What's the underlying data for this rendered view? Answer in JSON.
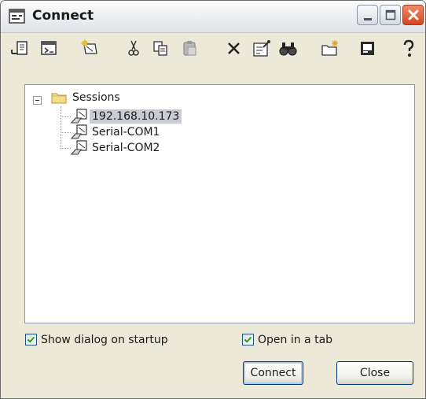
{
  "window": {
    "title": "Connect"
  },
  "titlebar_buttons": [
    {
      "name": "minimize",
      "icon": "minimize-icon"
    },
    {
      "name": "maximize",
      "icon": "maximize-icon"
    },
    {
      "name": "close",
      "icon": "close-icon"
    }
  ],
  "toolbar": {
    "items": [
      {
        "icon": "quick-connect-icon"
      },
      {
        "icon": "connect-in-tab-icon"
      },
      {
        "icon": "new-session-icon"
      },
      {
        "icon": "cut-icon"
      },
      {
        "icon": "copy-icon"
      },
      {
        "icon": "paste-icon"
      },
      {
        "icon": "delete-icon"
      },
      {
        "icon": "properties-icon"
      },
      {
        "icon": "find-icon"
      },
      {
        "icon": "new-folder-icon"
      },
      {
        "icon": "desktop-shortcut-icon"
      },
      {
        "icon": "help-icon"
      }
    ]
  },
  "tree": {
    "root": {
      "label": "Sessions",
      "icon": "folder-icon",
      "expanded": true
    },
    "sessions": [
      {
        "label": "192.168.10.173",
        "icon": "session-icon",
        "selected": true
      },
      {
        "label": "Serial-COM1",
        "icon": "session-icon",
        "selected": false
      },
      {
        "label": "Serial-COM2",
        "icon": "session-icon",
        "selected": false
      }
    ]
  },
  "options": {
    "show_dialog_on_startup": {
      "label": "Show dialog on startup",
      "checked": true
    },
    "open_in_a_tab": {
      "label": "Open in a tab",
      "checked": true
    }
  },
  "buttons": {
    "connect_label": "Connect",
    "close_label": "Close"
  },
  "colors": {
    "window_bg": "#ece9d8",
    "selection_bg": "#c9ccd3",
    "close_button": "#d8431e",
    "button_border": "#003c74"
  }
}
